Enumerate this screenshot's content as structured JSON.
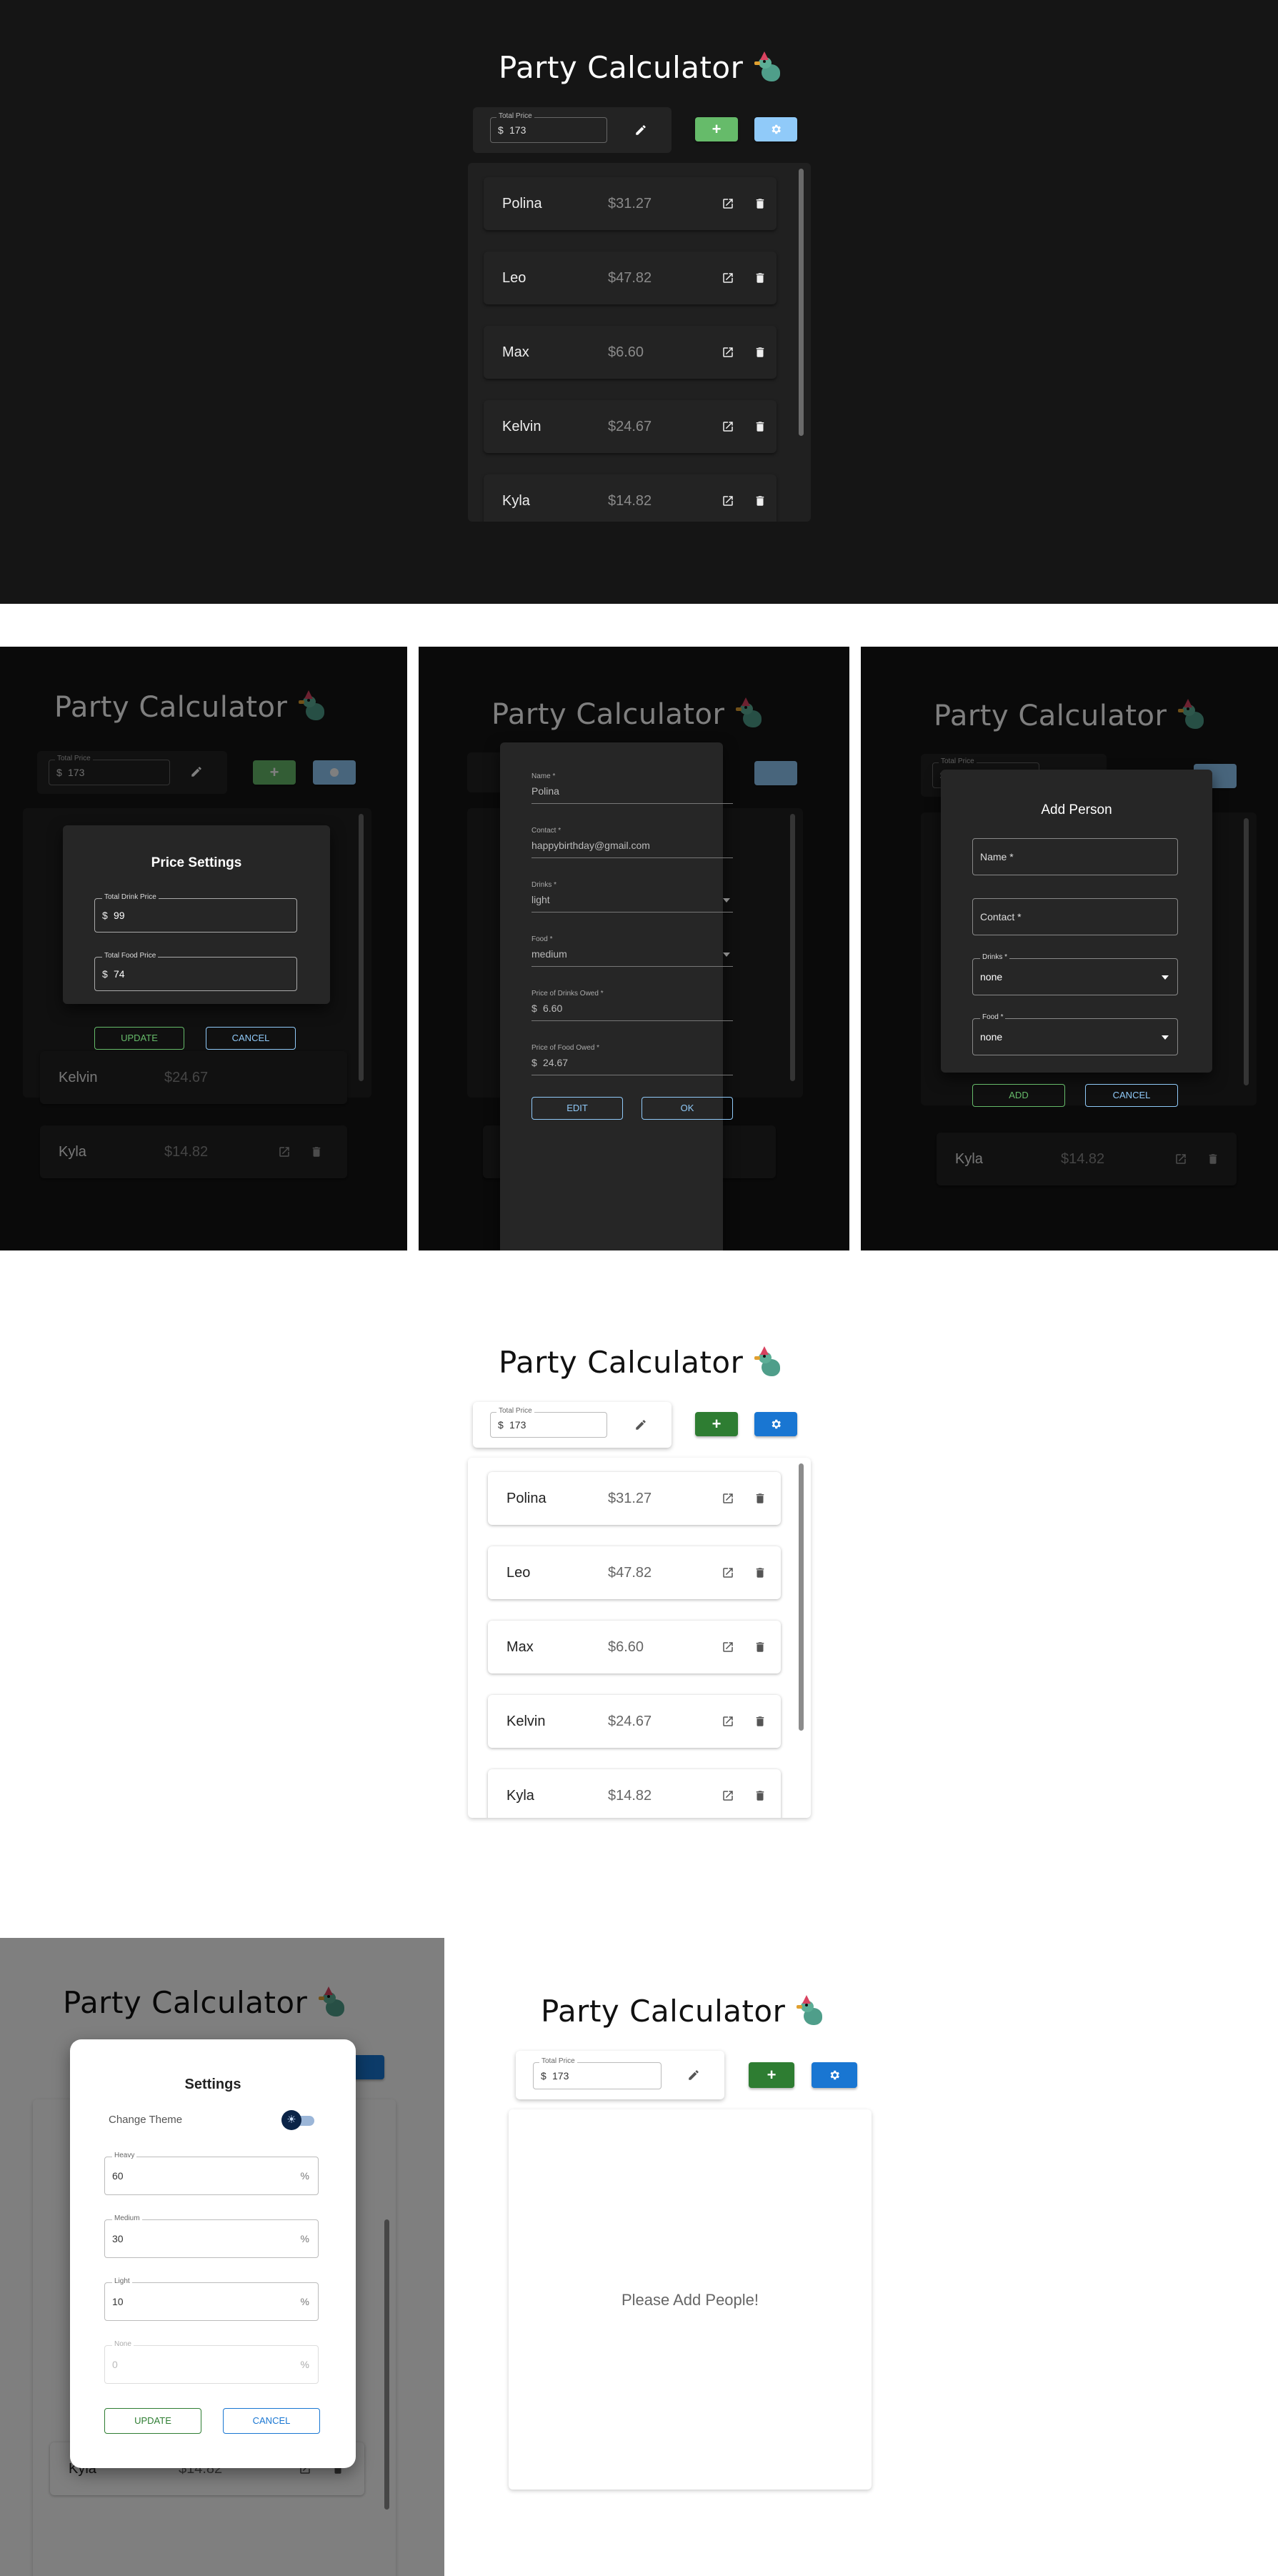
{
  "app": {
    "title": "Party Calculator",
    "bird_icon": "party-bird-icon"
  },
  "toolbar": {
    "total_price_label": "Total Price",
    "currency": "$",
    "total_price_value": "173",
    "add_symbol": "+",
    "edit_icon": "pencil-icon",
    "settings_icon": "gear-icon"
  },
  "people": [
    {
      "name": "Polina",
      "price": "$31.27"
    },
    {
      "name": "Leo",
      "price": "$47.82"
    },
    {
      "name": "Max",
      "price": "$6.60"
    },
    {
      "name": "Kelvin",
      "price": "$24.67"
    },
    {
      "name": "Kyla",
      "price": "$14.82"
    }
  ],
  "price_settings": {
    "title": "Price Settings",
    "drink_label": "Total Drink Price",
    "drink_value": "99",
    "food_label": "Total Food Price",
    "food_value": "74",
    "currency": "$",
    "update": "UPDATE",
    "cancel": "CANCEL"
  },
  "person_detail": {
    "name_label": "Name *",
    "name_value": "Polina",
    "contact_label": "Contact *",
    "contact_value": "happybirthday@gmail.com",
    "drinks_label": "Drinks *",
    "drinks_value": "light",
    "food_label": "Food *",
    "food_value": "medium",
    "drinks_owed_label": "Price of Drinks Owed *",
    "drinks_owed_value": "6.60",
    "food_owed_label": "Price of Food Owed *",
    "food_owed_value": "24.67",
    "currency": "$",
    "edit": "EDIT",
    "ok": "OK"
  },
  "add_person": {
    "title": "Add Person",
    "name_placeholder": "Name *",
    "contact_placeholder": "Contact *",
    "drinks_label": "Drinks *",
    "drinks_value": "none",
    "food_label": "Food *",
    "food_value": "none",
    "add": "ADD",
    "cancel": "CANCEL"
  },
  "settings": {
    "title": "Settings",
    "theme_label": "Change Theme",
    "heavy_label": "Heavy",
    "heavy_value": "60",
    "medium_label": "Medium",
    "medium_value": "30",
    "light_label": "Light",
    "light_value": "10",
    "none_label": "None",
    "none_value": "0",
    "suffix": "%",
    "update": "UPDATE",
    "cancel": "CANCEL"
  },
  "empty_state": {
    "message": "Please Add People!"
  },
  "colors": {
    "dark_bg": "#151515",
    "green_dark_theme": "#66bb6a",
    "blue_dark_theme": "#90caf9",
    "green_light_theme": "#2e7d32",
    "blue_light_theme": "#1976d2"
  }
}
